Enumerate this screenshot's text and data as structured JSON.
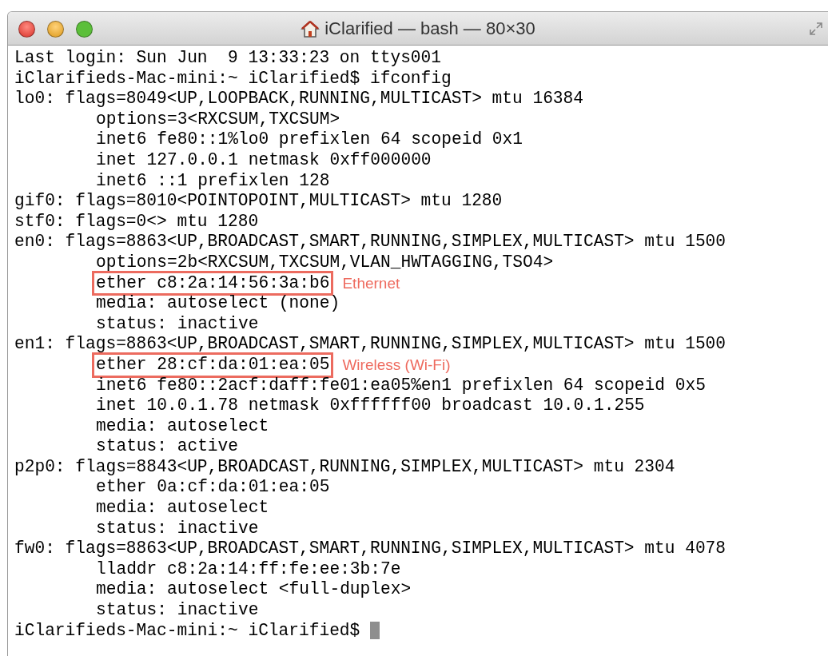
{
  "window": {
    "title": "iClarified — bash — 80×30"
  },
  "terminal": {
    "lines": [
      {
        "text": "Last login: Sun Jun  9 13:33:23 on ttys001"
      },
      {
        "text": "iClarifieds-Mac-mini:~ iClarified$ ifconfig"
      },
      {
        "text": "lo0: flags=8049<UP,LOOPBACK,RUNNING,MULTICAST> mtu 16384",
        "children": [
          {
            "text": "options=3<RXCSUM,TXCSUM>"
          },
          {
            "text": "inet6 fe80::1%lo0 prefixlen 64 scopeid 0x1"
          },
          {
            "text": "inet 127.0.0.1 netmask 0xff000000"
          },
          {
            "text": "inet6 ::1 prefixlen 128"
          }
        ]
      },
      {
        "text": "gif0: flags=8010<POINTOPOINT,MULTICAST> mtu 1280"
      },
      {
        "text": "stf0: flags=0<> mtu 1280"
      },
      {
        "text": "en0: flags=8863<UP,BROADCAST,SMART,RUNNING,SIMPLEX,MULTICAST> mtu 1500",
        "children": [
          {
            "text": "options=2b<RXCSUM,TXCSUM,VLAN_HWTAGGING,TSO4>"
          },
          {
            "text": "ether c8:2a:14:56:3a:b6",
            "highlighted": true,
            "note": "Ethernet"
          },
          {
            "text": "media: autoselect (none)"
          },
          {
            "text": "status: inactive"
          }
        ]
      },
      {
        "text": "en1: flags=8863<UP,BROADCAST,SMART,RUNNING,SIMPLEX,MULTICAST> mtu 1500",
        "children": [
          {
            "text": "ether 28:cf:da:01:ea:05",
            "highlighted": true,
            "note": "Wireless (Wi-Fi)"
          },
          {
            "text": "inet6 fe80::2acf:daff:fe01:ea05%en1 prefixlen 64 scopeid 0x5"
          },
          {
            "text": "inet 10.0.1.78 netmask 0xffffff00 broadcast 10.0.1.255"
          },
          {
            "text": "media: autoselect"
          },
          {
            "text": "status: active"
          }
        ]
      },
      {
        "text": "p2p0: flags=8843<UP,BROADCAST,RUNNING,SIMPLEX,MULTICAST> mtu 2304",
        "children": [
          {
            "text": "ether 0a:cf:da:01:ea:05"
          },
          {
            "text": "media: autoselect"
          },
          {
            "text": "status: inactive"
          }
        ]
      },
      {
        "text": "fw0: flags=8863<UP,BROADCAST,SMART,RUNNING,SIMPLEX,MULTICAST> mtu 4078",
        "children": [
          {
            "text": "lladdr c8:2a:14:ff:fe:ee:3b:7e"
          },
          {
            "text": "media: autoselect <full-duplex>"
          },
          {
            "text": "status: inactive"
          }
        ]
      },
      {
        "text": "iClarifieds-Mac-mini:~ iClarified$",
        "cursor": true
      }
    ]
  }
}
